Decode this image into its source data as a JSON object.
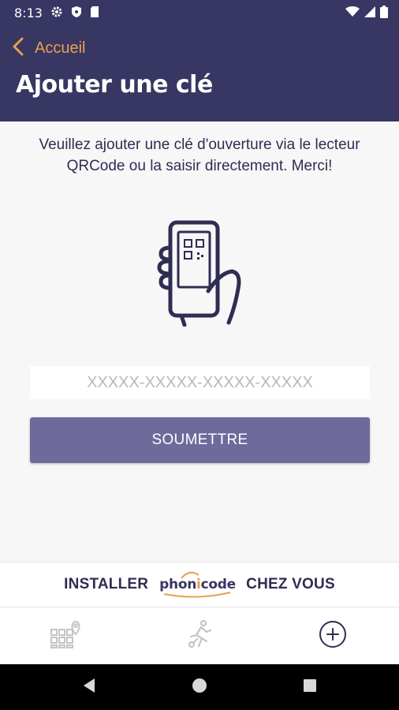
{
  "status": {
    "time": "8:13"
  },
  "header": {
    "back_label": "Accueil",
    "title": "Ajouter une clé"
  },
  "content": {
    "instructions": "Veuillez ajouter une clé d'ouverture via le lecteur QRCode ou la saisir directement. Merci!",
    "key_placeholder": "XXXXX-XXXXX-XXXXX-XXXXX",
    "key_value": "",
    "submit_label": "SOUMETTRE"
  },
  "banner": {
    "left_text": "INSTALLER",
    "brand": "phonicode",
    "right_text": "CHEZ VOUS"
  },
  "bottom_nav": {
    "items": [
      {
        "icon": "grid-location-icon",
        "active": false
      },
      {
        "icon": "running-person-key-icon",
        "active": false
      },
      {
        "icon": "add-circle-icon",
        "active": true
      }
    ]
  },
  "colors": {
    "primary": "#383662",
    "accent": "#e8a04c",
    "button": "#6e6a9c"
  }
}
